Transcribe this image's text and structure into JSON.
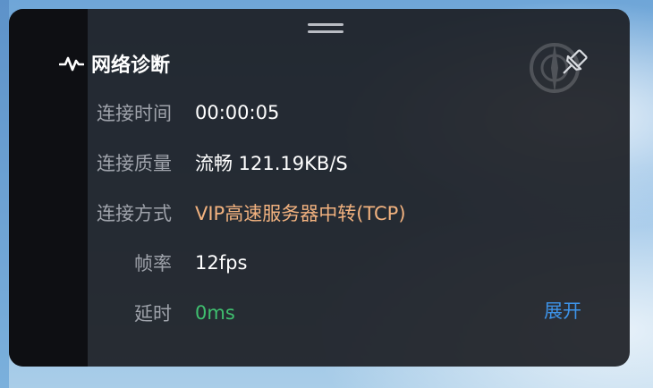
{
  "panel": {
    "title": "网络诊断",
    "title_icon": "pulse-icon",
    "pin_icon": "pin-icon",
    "drag_icon": "drag-handle-icon"
  },
  "rows": [
    {
      "label": "连接时间",
      "value": "00:00:05"
    },
    {
      "label": "连接质量",
      "value": "流畅 121.19KB/S"
    },
    {
      "label": "连接方式",
      "value": "VIP高速服务器中转(TCP)"
    },
    {
      "label": "帧率",
      "value": "12fps"
    },
    {
      "label": "延时",
      "value": "0ms"
    }
  ],
  "expand_label": "展开",
  "colors": {
    "panel_bg": "#1c1e24",
    "label": "#9fa3ab",
    "value": "#ffffff",
    "connection_method": "#f2b27f",
    "latency": "#3fbf6f",
    "link": "#3d93e8"
  }
}
